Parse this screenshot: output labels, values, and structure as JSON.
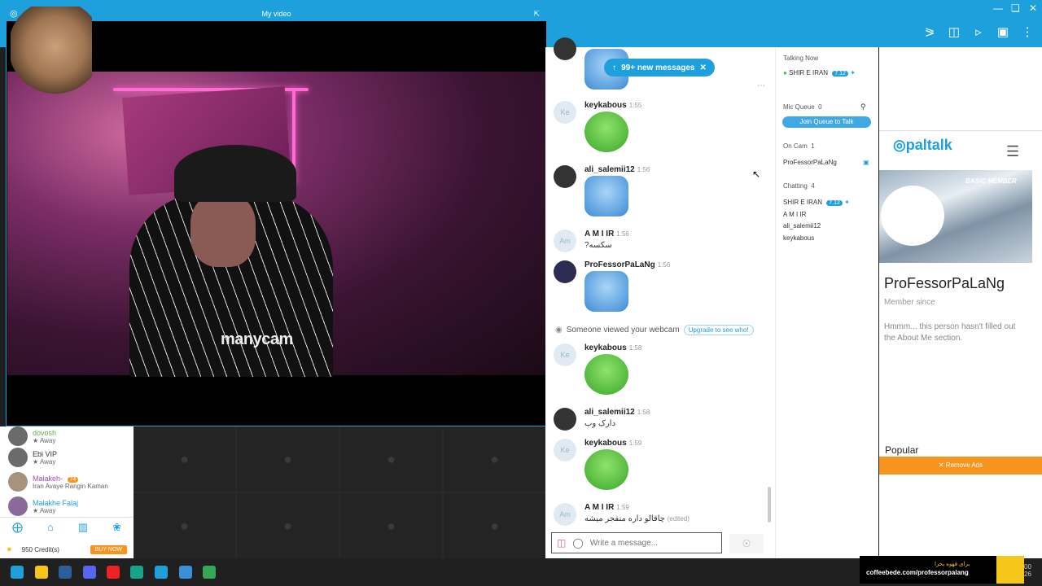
{
  "video": {
    "title": "My video",
    "watermark": "manycam"
  },
  "chat": {
    "new_messages": "99+ new messages",
    "messages": [
      {
        "initials": "Ke",
        "name": "keykabous",
        "time": "1:55"
      },
      {
        "initials": "",
        "name": "ali_salemii12",
        "time": "1:56"
      },
      {
        "initials": "Am",
        "name": "A M I IR",
        "time": "1:56",
        "text": "سکسه?"
      },
      {
        "initials": "",
        "name": "ProFessorPaLaNg",
        "time": "1:56"
      },
      {
        "initials": "Ke",
        "name": "keykabous",
        "time": "1:58"
      },
      {
        "initials": "",
        "name": "ali_salemii12",
        "time": "1:58",
        "text": "دارک وب"
      },
      {
        "initials": "Ke",
        "name": "keykabous",
        "time": "1:59"
      },
      {
        "initials": "Am",
        "name": "A M I IR",
        "time": "1:59",
        "text": "چاقالو داره منفجر میشه",
        "edited": "(edited)"
      }
    ],
    "viewed_notice": "Someone viewed your webcam",
    "upgrade": "Upgrade to see who!",
    "composer_placeholder": "Write a message..."
  },
  "room": {
    "talking_now_label": "Talking Now",
    "talking_user": "SHIR E IRAN",
    "talking_badge": "7.12",
    "mic_queue_label": "Mic Queue",
    "mic_queue_count": "0",
    "join_queue": "Join Queue to Talk",
    "on_cam_label": "On Cam",
    "on_cam_count": "1",
    "on_cam_user": "ProFessorPaLaNg",
    "chatting_label": "Chatting",
    "chatting_count": "4",
    "chatting_users": [
      "SHIR E IRAN",
      "A M I IR",
      "ali_salemii12",
      "keykabous"
    ]
  },
  "profile": {
    "logo": "paltalk",
    "member_type": "BASIC MEMBER",
    "name": "ProFessorPaLaNg",
    "since": "Member since",
    "about": "Hmmm... this person hasn't filled out the About Me section.",
    "popular": "Popular",
    "remove_ads": "✕ Remove Ads"
  },
  "left": {
    "users": [
      {
        "name": "dovosh",
        "status": "Away"
      },
      {
        "name": "Ebi VIP",
        "status": "Away"
      },
      {
        "name": "Malakeh-",
        "badge": "74",
        "status": "Iran Avaye Rangin Kaman"
      },
      {
        "name": "Malakhe Falaj",
        "status": "Away"
      }
    ],
    "credits": "950 Credit(s)",
    "buy_now": "BUY NOW"
  },
  "promo": {
    "line1": "برای قهوه بخرا",
    "line2": "coffeebede.com/professorpalang"
  },
  "tray": {
    "line1": "00",
    "line2": "26"
  }
}
